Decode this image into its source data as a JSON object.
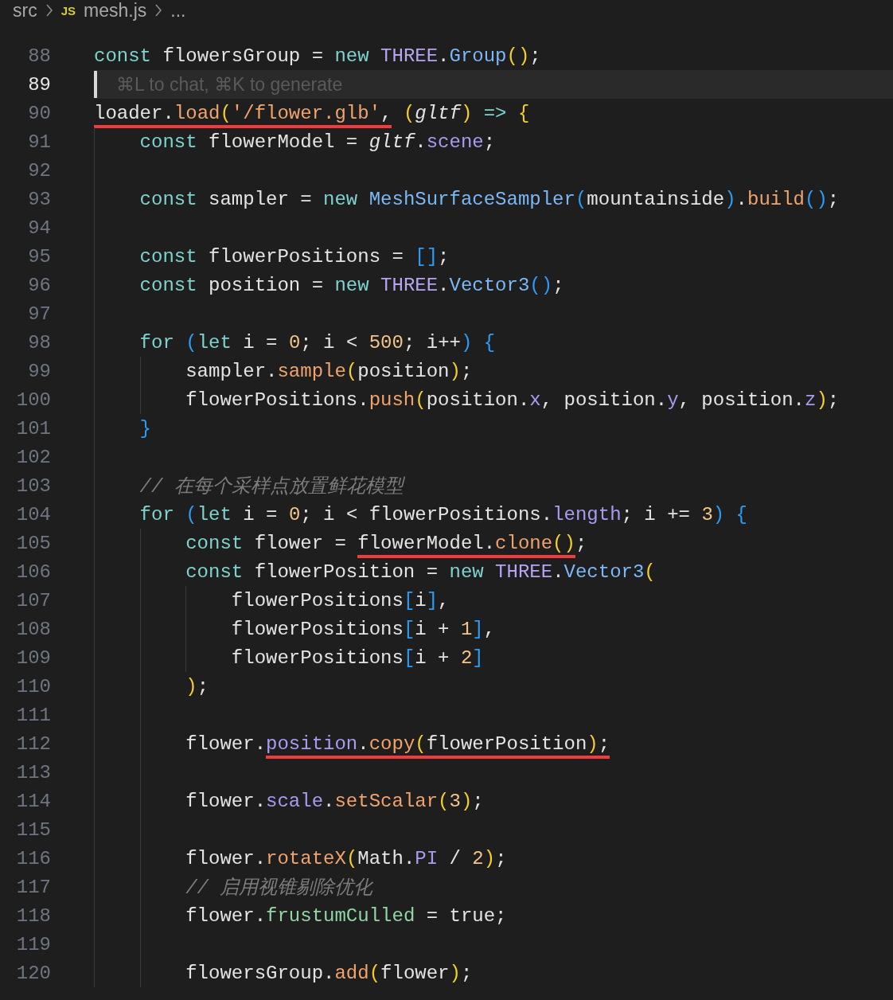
{
  "breadcrumb": [
    {
      "kind": "folder",
      "text": "src"
    },
    {
      "kind": "file",
      "badge": "JS",
      "text": "mesh.js"
    },
    {
      "kind": "more",
      "text": "..."
    }
  ],
  "lines": [
    {
      "number": "88",
      "active": false,
      "tokens": [
        {
          "text": "const",
          "kind": "kw"
        },
        {
          "text": " flowersGroup = ",
          "kind": "plain"
        },
        {
          "text": "new",
          "kind": "kw"
        },
        {
          "text": " THREE",
          "kind": "cls"
        },
        {
          "text": ".",
          "kind": "plain"
        },
        {
          "text": "Group",
          "kind": "type"
        },
        {
          "text": "()",
          "kind": "p1"
        },
        {
          "text": ";",
          "kind": "plain"
        }
      ]
    },
    {
      "number": "89",
      "active": true,
      "placeholder": "⌘L to chat, ⌘K to generate"
    },
    {
      "number": "90",
      "active": false,
      "tokens": [
        {
          "text": "loader.",
          "kind": "plain",
          "underlined": true
        },
        {
          "text": "load",
          "kind": "fn",
          "underlined": true
        },
        {
          "text": "(",
          "kind": "p1",
          "underlined": true
        },
        {
          "text": "'/flower.glb'",
          "kind": "str",
          "underlined": true
        },
        {
          "text": ",",
          "kind": "plain",
          "underlined": true
        },
        {
          "text": " (",
          "kind": "p1"
        },
        {
          "text": "gltf",
          "kind": "param"
        },
        {
          "text": ")",
          "kind": "p1"
        },
        {
          "text": " => ",
          "kind": "kw"
        },
        {
          "text": "{",
          "kind": "p1"
        }
      ]
    },
    {
      "number": "91",
      "active": false,
      "tokens": [
        {
          "text": "    const",
          "kind": "kw"
        },
        {
          "text": " flowerModel = ",
          "kind": "plain"
        },
        {
          "text": "gltf",
          "kind": "param"
        },
        {
          "text": ".",
          "kind": "plain"
        },
        {
          "text": "scene",
          "kind": "prop"
        },
        {
          "text": ";",
          "kind": "plain"
        }
      ]
    },
    {
      "number": "92",
      "active": false
    },
    {
      "number": "93",
      "active": false,
      "tokens": [
        {
          "text": "    const",
          "kind": "kw"
        },
        {
          "text": " sampler = ",
          "kind": "plain"
        },
        {
          "text": "new",
          "kind": "kw"
        },
        {
          "text": " MeshSurfaceSampler",
          "kind": "type"
        },
        {
          "text": "(",
          "kind": "p2"
        },
        {
          "text": "mountainside",
          "kind": "plain"
        },
        {
          "text": ")",
          "kind": "p2"
        },
        {
          "text": ".",
          "kind": "plain"
        },
        {
          "text": "build",
          "kind": "fn"
        },
        {
          "text": "()",
          "kind": "p2"
        },
        {
          "text": ";",
          "kind": "plain"
        }
      ]
    },
    {
      "number": "94",
      "active": false
    },
    {
      "number": "95",
      "active": false,
      "tokens": [
        {
          "text": "    const",
          "kind": "kw"
        },
        {
          "text": " flowerPositions = ",
          "kind": "plain"
        },
        {
          "text": "[]",
          "kind": "p2"
        },
        {
          "text": ";",
          "kind": "plain"
        }
      ]
    },
    {
      "number": "96",
      "active": false,
      "tokens": [
        {
          "text": "    const",
          "kind": "kw"
        },
        {
          "text": " position = ",
          "kind": "plain"
        },
        {
          "text": "new",
          "kind": "kw"
        },
        {
          "text": " THREE",
          "kind": "cls"
        },
        {
          "text": ".",
          "kind": "plain"
        },
        {
          "text": "Vector3",
          "kind": "type"
        },
        {
          "text": "()",
          "kind": "p2"
        },
        {
          "text": ";",
          "kind": "plain"
        }
      ]
    },
    {
      "number": "97",
      "active": false
    },
    {
      "number": "98",
      "active": false,
      "tokens": [
        {
          "text": "    for",
          "kind": "kw"
        },
        {
          "text": " (",
          "kind": "p2"
        },
        {
          "text": "let",
          "kind": "kw"
        },
        {
          "text": " i = ",
          "kind": "plain"
        },
        {
          "text": "0",
          "kind": "num"
        },
        {
          "text": "; i < ",
          "kind": "plain"
        },
        {
          "text": "500",
          "kind": "num"
        },
        {
          "text": "; i++",
          "kind": "plain"
        },
        {
          "text": ")",
          "kind": "p2"
        },
        {
          "text": " {",
          "kind": "p2"
        }
      ]
    },
    {
      "number": "99",
      "active": false,
      "tokens": [
        {
          "text": "        sampler.",
          "kind": "plain"
        },
        {
          "text": "sample",
          "kind": "fn"
        },
        {
          "text": "(",
          "kind": "p1"
        },
        {
          "text": "position",
          "kind": "plain"
        },
        {
          "text": ")",
          "kind": "p1"
        },
        {
          "text": ";",
          "kind": "plain"
        }
      ]
    },
    {
      "number": "100",
      "active": false,
      "tokens": [
        {
          "text": "        flowerPositions.",
          "kind": "plain"
        },
        {
          "text": "push",
          "kind": "fn"
        },
        {
          "text": "(",
          "kind": "p1"
        },
        {
          "text": "position.",
          "kind": "plain"
        },
        {
          "text": "x",
          "kind": "prop"
        },
        {
          "text": ", position.",
          "kind": "plain"
        },
        {
          "text": "y",
          "kind": "prop"
        },
        {
          "text": ", position.",
          "kind": "plain"
        },
        {
          "text": "z",
          "kind": "prop"
        },
        {
          "text": ")",
          "kind": "p1"
        },
        {
          "text": ";",
          "kind": "plain"
        }
      ]
    },
    {
      "number": "101",
      "active": false,
      "tokens": [
        {
          "text": "    }",
          "kind": "p2"
        }
      ]
    },
    {
      "number": "102",
      "active": false
    },
    {
      "number": "103",
      "active": false,
      "tokens": [
        {
          "text": "    // 在每个采样点放置鲜花模型",
          "kind": "comment"
        }
      ]
    },
    {
      "number": "104",
      "active": false,
      "tokens": [
        {
          "text": "    for",
          "kind": "kw"
        },
        {
          "text": " (",
          "kind": "p2"
        },
        {
          "text": "let",
          "kind": "kw"
        },
        {
          "text": " i = ",
          "kind": "plain"
        },
        {
          "text": "0",
          "kind": "num"
        },
        {
          "text": "; i < flowerPositions.",
          "kind": "plain"
        },
        {
          "text": "length",
          "kind": "prop"
        },
        {
          "text": "; i += ",
          "kind": "plain"
        },
        {
          "text": "3",
          "kind": "num"
        },
        {
          "text": ")",
          "kind": "p2"
        },
        {
          "text": " {",
          "kind": "p2"
        }
      ]
    },
    {
      "number": "105",
      "active": false,
      "tokens": [
        {
          "text": "        const",
          "kind": "kw"
        },
        {
          "text": " flower = ",
          "kind": "plain"
        },
        {
          "text": "flowerModel.",
          "kind": "plain",
          "underlined": true
        },
        {
          "text": "clone",
          "kind": "fn",
          "underlined": true
        },
        {
          "text": "()",
          "kind": "p1",
          "underlined": true
        },
        {
          "text": ";",
          "kind": "plain"
        }
      ]
    },
    {
      "number": "106",
      "active": false,
      "tokens": [
        {
          "text": "        const",
          "kind": "kw"
        },
        {
          "text": " flowerPosition = ",
          "kind": "plain"
        },
        {
          "text": "new",
          "kind": "kw"
        },
        {
          "text": " THREE",
          "kind": "cls"
        },
        {
          "text": ".",
          "kind": "plain"
        },
        {
          "text": "Vector3",
          "kind": "type"
        },
        {
          "text": "(",
          "kind": "p1"
        }
      ]
    },
    {
      "number": "107",
      "active": false,
      "tokens": [
        {
          "text": "            flowerPositions",
          "kind": "plain"
        },
        {
          "text": "[",
          "kind": "p2"
        },
        {
          "text": "i",
          "kind": "plain"
        },
        {
          "text": "]",
          "kind": "p2"
        },
        {
          "text": ",",
          "kind": "plain"
        }
      ]
    },
    {
      "number": "108",
      "active": false,
      "tokens": [
        {
          "text": "            flowerPositions",
          "kind": "plain"
        },
        {
          "text": "[",
          "kind": "p2"
        },
        {
          "text": "i + ",
          "kind": "plain"
        },
        {
          "text": "1",
          "kind": "num"
        },
        {
          "text": "]",
          "kind": "p2"
        },
        {
          "text": ",",
          "kind": "plain"
        }
      ]
    },
    {
      "number": "109",
      "active": false,
      "tokens": [
        {
          "text": "            flowerPositions",
          "kind": "plain"
        },
        {
          "text": "[",
          "kind": "p2"
        },
        {
          "text": "i + ",
          "kind": "plain"
        },
        {
          "text": "2",
          "kind": "num"
        },
        {
          "text": "]",
          "kind": "p2"
        }
      ]
    },
    {
      "number": "110",
      "active": false,
      "tokens": [
        {
          "text": "        )",
          "kind": "p1"
        },
        {
          "text": ";",
          "kind": "plain"
        }
      ]
    },
    {
      "number": "111",
      "active": false
    },
    {
      "number": "112",
      "active": false,
      "tokens": [
        {
          "text": "        flower.",
          "kind": "plain"
        },
        {
          "text": "position",
          "kind": "prop",
          "underlined": true
        },
        {
          "text": ".",
          "kind": "plain",
          "underlined": true
        },
        {
          "text": "copy",
          "kind": "fn",
          "underlined": true
        },
        {
          "text": "(",
          "kind": "p1",
          "underlined": true
        },
        {
          "text": "flowerPosition",
          "kind": "plain",
          "underlined": true
        },
        {
          "text": ")",
          "kind": "p1",
          "underlined": true
        },
        {
          "text": ";",
          "kind": "plain",
          "underlined": true
        }
      ]
    },
    {
      "number": "113",
      "active": false
    },
    {
      "number": "114",
      "active": false,
      "tokens": [
        {
          "text": "        flower.",
          "kind": "plain"
        },
        {
          "text": "scale",
          "kind": "prop"
        },
        {
          "text": ".",
          "kind": "plain"
        },
        {
          "text": "setScalar",
          "kind": "fn"
        },
        {
          "text": "(",
          "kind": "p1"
        },
        {
          "text": "3",
          "kind": "num"
        },
        {
          "text": ")",
          "kind": "p1"
        },
        {
          "text": ";",
          "kind": "plain"
        }
      ]
    },
    {
      "number": "115",
      "active": false
    },
    {
      "number": "116",
      "active": false,
      "tokens": [
        {
          "text": "        flower.",
          "kind": "plain"
        },
        {
          "text": "rotateX",
          "kind": "fn"
        },
        {
          "text": "(",
          "kind": "p1"
        },
        {
          "text": "Math.",
          "kind": "plain"
        },
        {
          "text": "PI",
          "kind": "prop"
        },
        {
          "text": " / ",
          "kind": "plain"
        },
        {
          "text": "2",
          "kind": "num"
        },
        {
          "text": ")",
          "kind": "p1"
        },
        {
          "text": ";",
          "kind": "plain"
        }
      ]
    },
    {
      "number": "117",
      "active": false,
      "tokens": [
        {
          "text": "        // 启用视锥剔除优化",
          "kind": "comment"
        }
      ]
    },
    {
      "number": "118",
      "active": false,
      "tokens": [
        {
          "text": "        flower.",
          "kind": "plain"
        },
        {
          "text": "frustumCulled",
          "kind": "field"
        },
        {
          "text": " = true;",
          "kind": "plain"
        }
      ]
    },
    {
      "number": "119",
      "active": false
    },
    {
      "number": "120",
      "active": false,
      "tokens": [
        {
          "text": "        flowersGroup.",
          "kind": "plain"
        },
        {
          "text": "add",
          "kind": "fn"
        },
        {
          "text": "(",
          "kind": "p1"
        },
        {
          "text": "flower",
          "kind": "plain"
        },
        {
          "text": ")",
          "kind": "p1"
        },
        {
          "text": ";",
          "kind": "plain"
        }
      ]
    }
  ]
}
